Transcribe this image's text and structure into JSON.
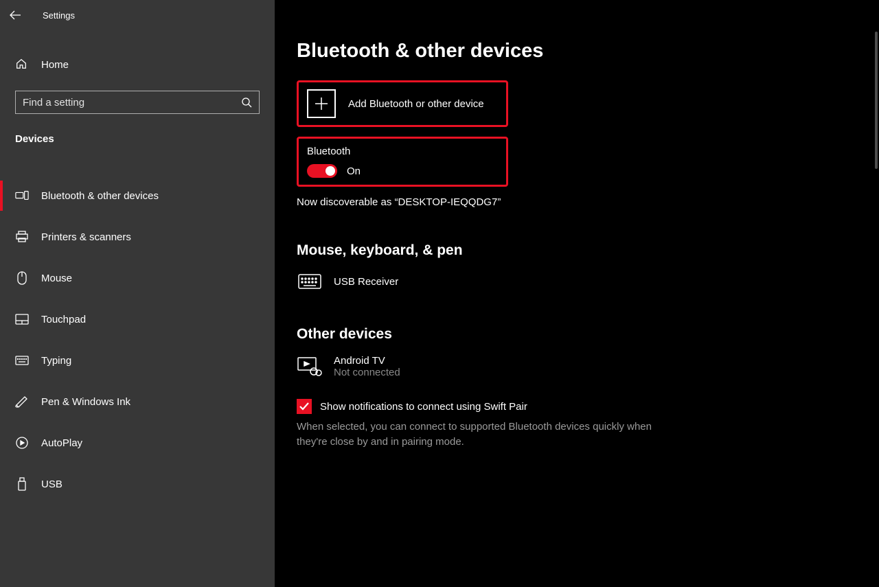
{
  "window": {
    "title": "Settings"
  },
  "sidebar": {
    "home_label": "Home",
    "search_placeholder": "Find a setting",
    "category": "Devices",
    "items": [
      {
        "label": "Bluetooth & other devices",
        "icon": "devices-icon",
        "active": true
      },
      {
        "label": "Printers & scanners",
        "icon": "printer-icon",
        "active": false
      },
      {
        "label": "Mouse",
        "icon": "mouse-icon",
        "active": false
      },
      {
        "label": "Touchpad",
        "icon": "touchpad-icon",
        "active": false
      },
      {
        "label": "Typing",
        "icon": "keyboard-icon",
        "active": false
      },
      {
        "label": "Pen & Windows Ink",
        "icon": "pen-icon",
        "active": false
      },
      {
        "label": "AutoPlay",
        "icon": "autoplay-icon",
        "active": false
      },
      {
        "label": "USB",
        "icon": "usb-icon",
        "active": false
      }
    ]
  },
  "main": {
    "title": "Bluetooth & other devices",
    "add_label": "Add Bluetooth or other device",
    "bluetooth_label": "Bluetooth",
    "toggle_state": "On",
    "discoverable": "Now discoverable as “DESKTOP-IEQQDG7”",
    "section_mkp": "Mouse, keyboard, & pen",
    "device_mkp": {
      "name": "USB Receiver"
    },
    "section_other": "Other devices",
    "device_other": {
      "name": "Android TV",
      "status": "Not connected"
    },
    "swift_pair_label": "Show notifications to connect using Swift Pair",
    "swift_pair_desc": "When selected, you can connect to supported Bluetooth devices quickly when they're close by and in pairing mode."
  }
}
